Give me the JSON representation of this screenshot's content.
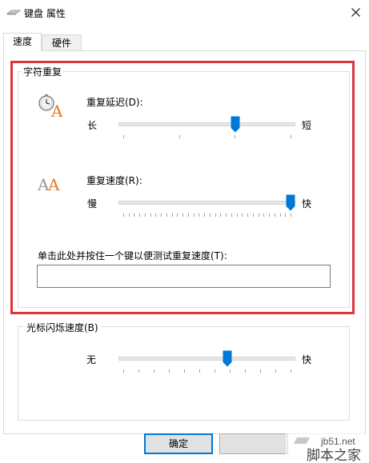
{
  "window": {
    "title": "键盘 属性",
    "close_icon": "close-icon",
    "app_icon": "keyboard-icon"
  },
  "tabs": [
    {
      "label": "速度",
      "selected": true
    },
    {
      "label": "硬件",
      "selected": false
    }
  ],
  "char_repeat": {
    "group_label": "字符重复",
    "delay": {
      "label": "重复延迟(D):",
      "min_label": "长",
      "max_label": "短",
      "value_fraction": 0.67,
      "tick_count": 4,
      "icon": "repeat-delay-icon"
    },
    "rate": {
      "label": "重复速度(R):",
      "min_label": "慢",
      "max_label": "快",
      "value_fraction": 1.0,
      "tick_count": 32,
      "icon": "repeat-rate-icon"
    },
    "test": {
      "label": "单击此处并按住一个键以便测试重复速度(T):",
      "value": ""
    }
  },
  "cursor_blink": {
    "group_label": "光标闪烁速度(B)",
    "min_label": "无",
    "max_label": "快",
    "value_fraction": 0.62,
    "tick_count": 12
  },
  "buttons": {
    "ok": "确定",
    "cancel": ""
  },
  "watermark": {
    "line1": "jb51.net",
    "line2": "脚本之家"
  },
  "colors": {
    "highlight": "#d9363e",
    "accent": "#0078d7",
    "icon_orange": "#e07b24"
  }
}
